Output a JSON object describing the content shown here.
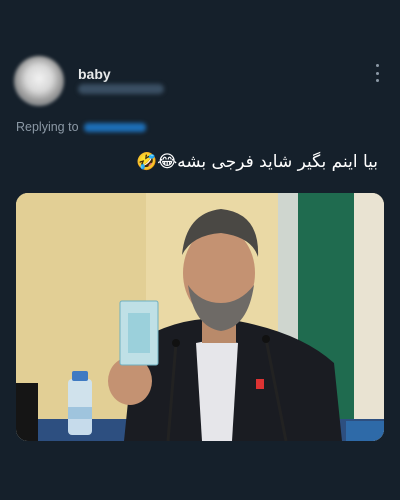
{
  "author": {
    "name": "baby",
    "avatar_icon": "avatar-blurred",
    "handle_visible": false
  },
  "reply": {
    "label": "Replying to",
    "handle_visible": false
  },
  "tweet": {
    "text": "بیا اینم بگیر شاید فرجی بشه😂🤣"
  },
  "icons": {
    "more": "more-vertical-icon"
  },
  "colors": {
    "background": "#15202b",
    "muted": "#8b98a5",
    "link": "#1d9bf0"
  }
}
